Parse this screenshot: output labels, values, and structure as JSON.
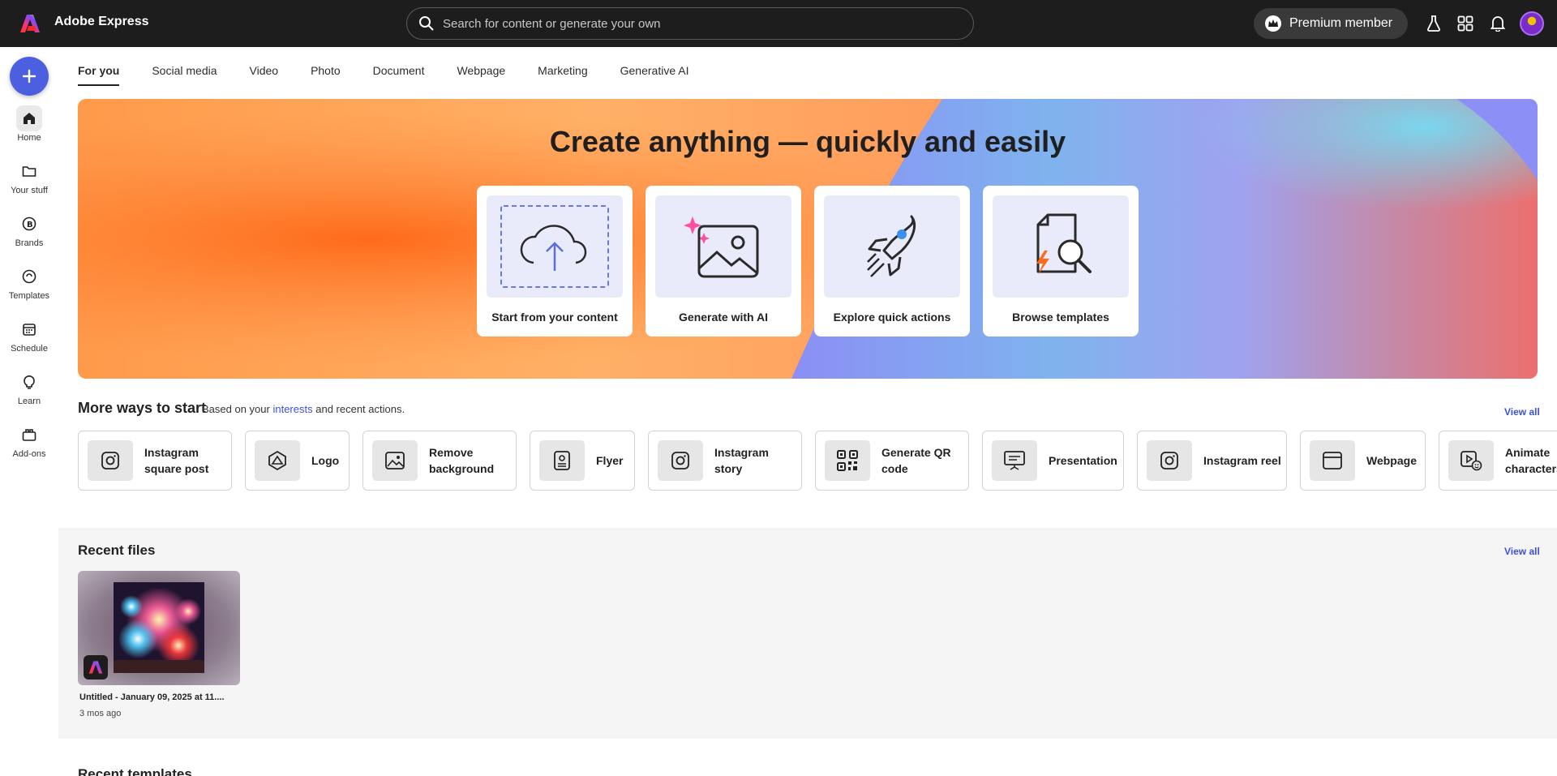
{
  "app": {
    "name": "Adobe Express",
    "brand_color": "#eb1000"
  },
  "search": {
    "placeholder": "Search for content or generate your own"
  },
  "header": {
    "premium_label": "Premium member"
  },
  "sidebar": {
    "create_icon": "plus-icon",
    "items": [
      {
        "label": "Home",
        "icon": "home-icon"
      },
      {
        "label": "Your stuff",
        "icon": "folder-icon"
      },
      {
        "label": "Brands",
        "icon": "brand-icon"
      },
      {
        "label": "Templates",
        "icon": "templates-icon"
      },
      {
        "label": "Schedule",
        "icon": "calendar-icon"
      },
      {
        "label": "Learn",
        "icon": "lightbulb-icon"
      },
      {
        "label": "Add-ons",
        "icon": "addons-icon"
      }
    ]
  },
  "tabs": [
    "For you",
    "Social media",
    "Video",
    "Photo",
    "Document",
    "Webpage",
    "Marketing",
    "Generative AI"
  ],
  "hero": {
    "title": "Create anything — quickly and easily",
    "cards": [
      {
        "label": "Start from your content",
        "icon": "cloud-upload-icon"
      },
      {
        "label": "Generate with AI",
        "icon": "ai-image-icon"
      },
      {
        "label": "Explore quick actions",
        "icon": "rocket-icon"
      },
      {
        "label": "Browse templates",
        "icon": "template-search-icon"
      }
    ]
  },
  "more_ways": {
    "title": "More ways to start",
    "subtitle_prefix": "Based on your",
    "subtitle_link": "interests",
    "subtitle_suffix": "and recent actions.",
    "view_all": "View all",
    "items": [
      {
        "label_1": "Instagram",
        "label_2": "square post",
        "icon": "instagram-icon"
      },
      {
        "label_1": "Logo",
        "label_2": "",
        "icon": "logo-icon"
      },
      {
        "label_1": "Remove",
        "label_2": "background",
        "icon": "remove-background-icon"
      },
      {
        "label_1": "Flyer",
        "label_2": "",
        "icon": "flyer-icon"
      },
      {
        "label_1": "Instagram",
        "label_2": "story",
        "icon": "instagram-icon"
      },
      {
        "label_1": "Generate QR",
        "label_2": "code",
        "icon": "qr-code-icon"
      },
      {
        "label_1": "Presentation",
        "label_2": "",
        "icon": "presentation-icon"
      },
      {
        "label_1": "Instagram reel",
        "label_2": "",
        "icon": "instagram-icon"
      },
      {
        "label_1": "Webpage",
        "label_2": "",
        "icon": "webpage-icon"
      },
      {
        "label_1": "Animate",
        "label_2": "characters",
        "icon": "animate-characters-icon"
      }
    ]
  },
  "recent_files": {
    "title": "Recent files",
    "view_all": "View all",
    "files": [
      {
        "name": "Untitled - January 09, 2025 at 11....",
        "time": "3 mos ago"
      }
    ]
  },
  "recent_templates": {
    "title": "Recent templates"
  }
}
